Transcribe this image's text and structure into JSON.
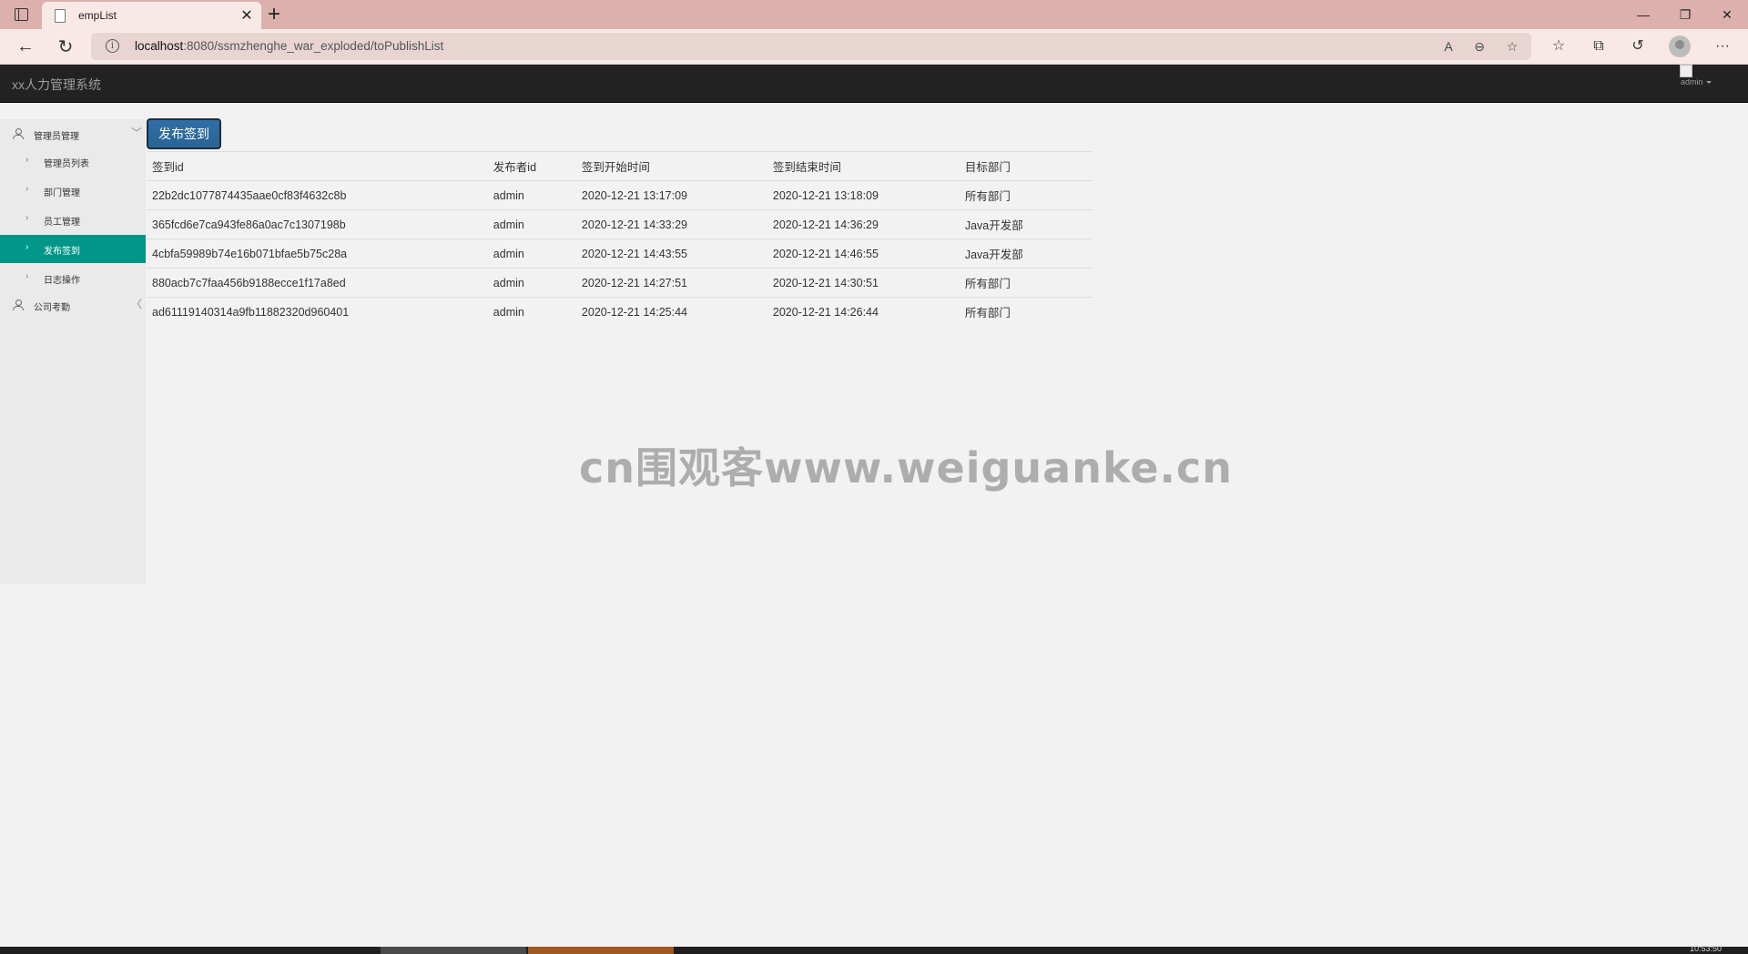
{
  "browser": {
    "tab_title": "empList",
    "tab_close": "✕",
    "new_tab": "+",
    "url_host": "localhost",
    "url_rest": ":8080/ssmzhenghe_war_exploded/toPublishList",
    "window_controls": {
      "minimize": "—",
      "restore": "❐",
      "close": "✕"
    },
    "nav_icons": {
      "back": "←",
      "reload": "↻",
      "info": "i",
      "read_aloud": "A",
      "zoom_out": "⊖",
      "favorite_add": "☆",
      "favorites": "☆",
      "collections": "⧉",
      "history": "↺",
      "more": "···"
    }
  },
  "app": {
    "brand": "xx人力管理系统",
    "user": "admin"
  },
  "sidebar": {
    "groups": [
      {
        "label": "管理员管理",
        "chevron": "﹀"
      },
      {
        "label": "公司考勤",
        "chevron": "〈"
      }
    ],
    "items": [
      {
        "label": "管理员列表"
      },
      {
        "label": "部门管理"
      },
      {
        "label": "员工管理"
      },
      {
        "label": "发布签到"
      },
      {
        "label": "日志操作"
      }
    ],
    "arrow": "›"
  },
  "main": {
    "publish_button": "发布签到",
    "table": {
      "columns": [
        "签到id",
        "发布者id",
        "签到开始时间",
        "签到结束时间",
        "目标部门"
      ],
      "rows": [
        [
          "22b2dc1077874435aae0cf83f4632c8b",
          "admin",
          "2020-12-21 13:17:09",
          "2020-12-21 13:18:09",
          "所有部门"
        ],
        [
          "365fcd6e7ca943fe86a0ac7c1307198b",
          "admin",
          "2020-12-21 14:33:29",
          "2020-12-21 14:36:29",
          "Java开发部"
        ],
        [
          "4cbfa59989b74e16b071bfae5b75c28a",
          "admin",
          "2020-12-21 14:43:55",
          "2020-12-21 14:46:55",
          "Java开发部"
        ],
        [
          "880acb7c7faa456b9188ecce1f17a8ed",
          "admin",
          "2020-12-21 14:27:51",
          "2020-12-21 14:30:51",
          "所有部门"
        ],
        [
          "ad61119140314a9fb11882320d960401",
          "admin",
          "2020-12-21 14:25:44",
          "2020-12-21 14:26:44",
          "所有部门"
        ]
      ]
    }
  },
  "watermark": "cn围观客www.weiguanke.cn",
  "taskbar": {
    "clock": "10:53:50"
  },
  "colors": {
    "tab_strip": "#dcb1ad",
    "navbar": "#222222",
    "active_item": "#009688",
    "button": "#337ab7"
  }
}
